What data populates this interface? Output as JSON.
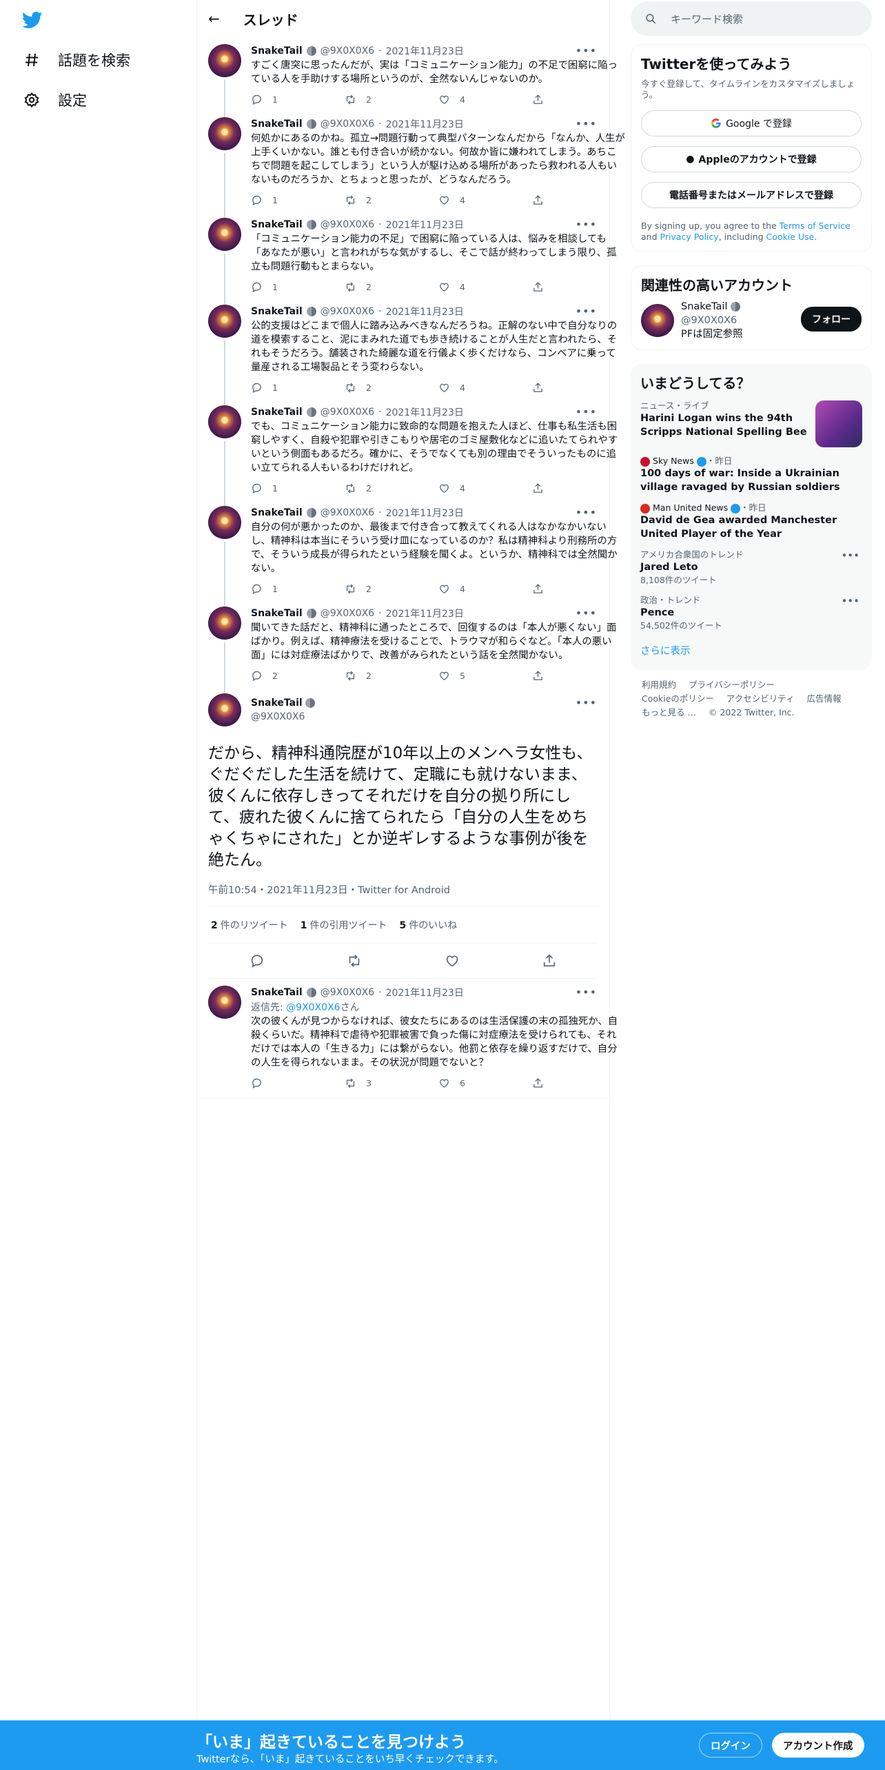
{
  "nav": {
    "explore": "話題を検索",
    "settings": "設定"
  },
  "header": {
    "title": "スレッド"
  },
  "author": {
    "name": "SnakeTail",
    "handle": "@9X0X0X6"
  },
  "tweets": [
    {
      "date": "2021年11月23日",
      "text": "すごく唐突に思ったんだが、実は「コミュニケーション能力」の不足で困窮に陥っている人を手助けする場所というのが、全然ないんじゃないのか。",
      "replies": "1",
      "retweets": "2",
      "likes": "4"
    },
    {
      "date": "2021年11月23日",
      "text": "何処かにあるのかね。孤立→問題行動って典型パターンなんだから「なんか、人生が上手くいかない。誰とも付き合いが続かない。何故か皆に嫌われてしまう。あちこちで問題を起こしてしまう」という人が駆け込める場所があったら救われる人もいないものだろうか、とちょっと思ったが、どうなんだろう。",
      "replies": "1",
      "retweets": "2",
      "likes": "4"
    },
    {
      "date": "2021年11月23日",
      "text": "「コミュニケーション能力の不足」で困窮に陥っている人は、悩みを相談しても「あなたが悪い」と言われがちな気がするし、そこで話が終わってしまう限り、孤立も問題行動もとまらない。",
      "replies": "1",
      "retweets": "2",
      "likes": "4"
    },
    {
      "date": "2021年11月23日",
      "text": "公的支援はどこまで個人に踏み込みべきなんだろうね。正解のない中で自分なりの道を模索すること、泥にまみれた道でも歩き続けることが人生だと言われたら、それもそうだろう。舗装された綺麗な道を行儀よく歩くだけなら、コンベアに乗って量産される工場製品とそう変わらない。",
      "replies": "1",
      "retweets": "2",
      "likes": "4"
    },
    {
      "date": "2021年11月23日",
      "text": "でも、コミュニケーション能力に致命的な問題を抱えた人ほど、仕事も私生活も困窮しやすく、自殺や犯罪や引きこもりや居宅のゴミ屋敷化などに追いたてられやすいという側面もあるだろ。確かに、そうでなくても別の理由でそういったものに追い立てられる人もいるわけだけれど。",
      "replies": "1",
      "retweets": "2",
      "likes": "4"
    },
    {
      "date": "2021年11月23日",
      "text": "自分の何が悪かったのか、最後まで付き合って教えてくれる人はなかなかいないし、精神科は本当にそういう受け皿になっているのか？私は精神科より刑務所の方で、そういう成長が得られたという経験を聞くよ。というか、精神科では全然聞かない。",
      "replies": "1",
      "retweets": "2",
      "likes": "4"
    },
    {
      "date": "2021年11月23日",
      "text": "聞いてきた話だと、精神科に通ったところで、回復するのは「本人が悪くない」面ばかり。例えば、精神療法を受けることで、トラウマが和らぐなど。「本人の悪い面」には対症療法ばかりで、改善がみられたという話を全然聞かない。",
      "replies": "2",
      "retweets": "2",
      "likes": "5"
    }
  ],
  "main_tweet": {
    "text": "だから、精神科通院歴が10年以上のメンヘラ女性も、ぐだぐだした生活を続けて、定職にも就けないまま、彼くんに依存しきってそれだけを自分の拠り所にして、疲れた彼くんに捨てられたら「自分の人生をめちゃくちゃにされた」とか逆ギレするような事例が後を絶たん。",
    "time": "午前10:54・2021年11月23日・Twitter for Android",
    "retweets_n": "2",
    "retweets_l": "件のリツイート",
    "quotes_n": "1",
    "quotes_l": "件の引用ツイート",
    "likes_n": "5",
    "likes_l": "件のいいね"
  },
  "reply_tweet": {
    "date": "2021年11月23日",
    "reply_prefix": "返信先: ",
    "reply_handle": "@9X0X0X6",
    "reply_suffix": "さん",
    "text": "次の彼くんが見つからなければ、彼女たちにあるのは生活保護の末の孤独死か、自殺くらいだ。精神科で虐待や犯罪被害で負った傷に対症療法を受けられても、それだけでは本人の「生きる力」には繋がらない。他罰と依存を繰り返すだけで、自分の人生を得られないまま。その状況が問題でないと？",
    "replies": "",
    "retweets": "3",
    "likes": "6"
  },
  "search": {
    "placeholder": "キーワード検索"
  },
  "signup": {
    "title": "Twitterを使ってみよう",
    "sub": "今すぐ登録して、タイムラインをカスタマイズしましょう。",
    "google": "Google で登録",
    "apple": "Appleのアカウントで登録",
    "phone": "電話番号またはメールアドレスで登録",
    "fine1": "By signing up, you agree to the ",
    "tos": "Terms of Service",
    "and": " and ",
    "privacy": "Privacy Policy",
    "including": ", including ",
    "cookie": "Cookie Use",
    "dot": "."
  },
  "related": {
    "title": "関連性の高いアカウント",
    "name": "SnakeTail",
    "handle": "@9X0X0X6",
    "bio": "PFは固定参照",
    "follow": "フォロー"
  },
  "trends": {
    "title": "いまどうしてる？",
    "items": [
      {
        "cat": "ニュース・ライブ",
        "title": "Harini Logan wins the 94th Scripps National Spelling Bee"
      },
      {
        "source": "Sky News",
        "when": "・昨日",
        "title": "100 days of war: Inside a Ukrainian village ravaged by Russian soldiers"
      },
      {
        "source": "Man United News",
        "when": "・昨日",
        "title": "David de Gea awarded Manchester United Player of the Year"
      },
      {
        "cat": "アメリカ合衆国のトレンド",
        "title": "Jared Leto",
        "count": "8,108件のツイート"
      },
      {
        "cat": "政治・トレンド",
        "title": "Pence",
        "count": "54,502件のツイート"
      }
    ],
    "show_more": "さらに表示"
  },
  "footer": {
    "links": [
      "利用規約",
      "プライバシーポリシー",
      "Cookieのポリシー",
      "アクセシビリティ",
      "広告情報",
      "もっと見る …",
      "© 2022 Twitter, Inc."
    ]
  },
  "bottom": {
    "title": "「いま」起きていることを見つけよう",
    "sub": "Twitterなら、「いま」起きていることをいち早くチェックできます。",
    "login": "ログイン",
    "signup": "アカウント作成"
  },
  "colors": {
    "accent": "#1d9bf0",
    "text": "#0f1419",
    "muted": "#536471"
  }
}
